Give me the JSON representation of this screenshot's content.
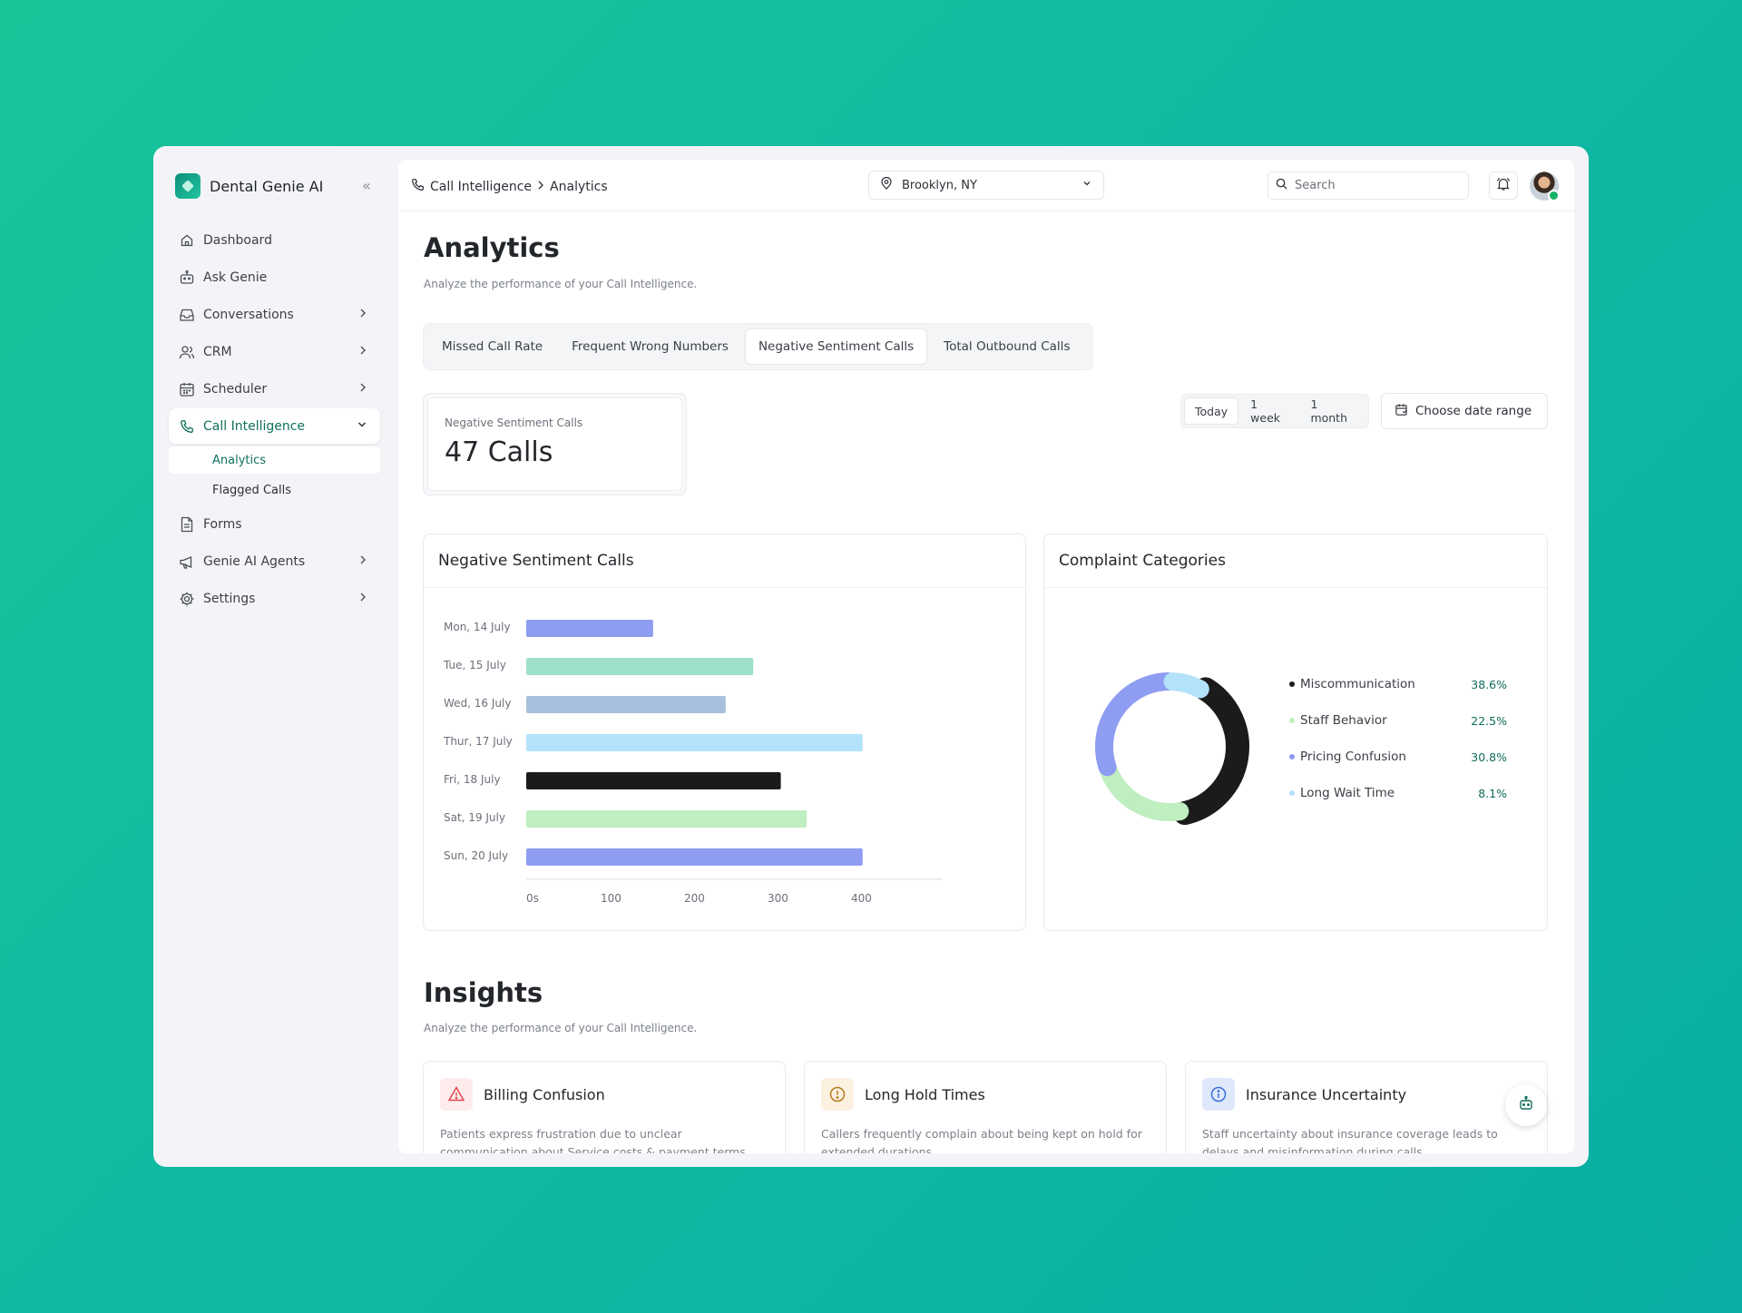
{
  "app": {
    "name": "Dental Genie AI"
  },
  "sidebar": {
    "items": [
      {
        "label": "Dashboard",
        "icon": "home-icon"
      },
      {
        "label": "Ask Genie",
        "icon": "robot-icon"
      },
      {
        "label": "Conversations",
        "icon": "inbox-icon"
      },
      {
        "label": "CRM",
        "icon": "users-icon"
      },
      {
        "label": "Scheduler",
        "icon": "calendar-icon"
      },
      {
        "label": "Call Intelligence",
        "icon": "phone-icon"
      },
      {
        "label": "Forms",
        "icon": "document-icon"
      },
      {
        "label": "Genie AI Agents",
        "icon": "megaphone-icon"
      },
      {
        "label": "Settings",
        "icon": "gear-icon"
      }
    ],
    "subitems": [
      "Analytics",
      "Flagged Calls"
    ]
  },
  "topbar": {
    "breadcrumb": [
      "Call Intelligence",
      "Analytics"
    ],
    "location": "Brooklyn, NY",
    "search_placeholder": "Search"
  },
  "page": {
    "title": "Analytics",
    "subtitle": "Analyze the performance of your Call Intelligence."
  },
  "tabs": [
    "Missed Call Rate",
    "Frequent Wrong Numbers",
    "Negative Sentiment Calls",
    "Total Outbound Calls"
  ],
  "stat": {
    "label": "Negative Sentiment Calls",
    "value": "47 Calls"
  },
  "range": [
    "Today",
    "1 week",
    "1 month"
  ],
  "date_range_label": "Choose date range",
  "bar_card_title": "Negative Sentiment Calls",
  "donut_card_title": "Complaint Categories",
  "chart_data": [
    {
      "type": "bar",
      "orientation": "horizontal",
      "title": "Negative Sentiment Calls",
      "categories": [
        "Mon, 14 July",
        "Tue, 15 July",
        "Wed, 16 July",
        "Thur, 17 July",
        "Fri, 18 July",
        "Sat, 19 July",
        "Sun, 20 July"
      ],
      "values": [
        152,
        272,
        239,
        403,
        305,
        336,
        403
      ],
      "colors": [
        "#8e9cf1",
        "#9ee0cb",
        "#a8c0dd",
        "#b3e2fb",
        "#1b1b1b",
        "#bfeec0",
        "#8e9cf1"
      ],
      "xticks": [
        "0s",
        "100",
        "200",
        "300",
        "400"
      ],
      "xlim": [
        0,
        500
      ],
      "grid": false
    },
    {
      "type": "pie",
      "variant": "donut",
      "title": "Complaint Categories",
      "labels": [
        "Miscommunication",
        "Staff Behavior",
        "Pricing Confusion",
        "Long Wait Time"
      ],
      "display_values": [
        "38.6%",
        "22.5%",
        "30.8%",
        "8.1%"
      ],
      "values": [
        38.6,
        22.5,
        30.8,
        8.1
      ],
      "colors": [
        "#1b1b1b",
        "#bfeec0",
        "#8e9cf1",
        "#b3e2fb"
      ],
      "legend": "right"
    }
  ],
  "insights": {
    "title": "Insights",
    "subtitle": "Analyze the performance of your Call Intelligence.",
    "cards": [
      {
        "title": "Billing Confusion",
        "text": "Patients express frustration due to unclear communication about Service costs & payment terms",
        "icon": "warning-triangle-icon",
        "accent": "#e5484d",
        "bg": "#fdecec"
      },
      {
        "title": "Long Hold Times",
        "text": "Callers frequently complain about being kept on hold for extended durations",
        "icon": "alert-circle-icon",
        "accent": "#b7791f",
        "bg": "#fcf0e0"
      },
      {
        "title": "Insurance Uncertainty",
        "text": "Staff uncertainty about insurance coverage leads to delays and misinformation during calls",
        "icon": "info-circle-icon",
        "accent": "#3b6fd8",
        "bg": "#dfe8fb"
      }
    ]
  }
}
